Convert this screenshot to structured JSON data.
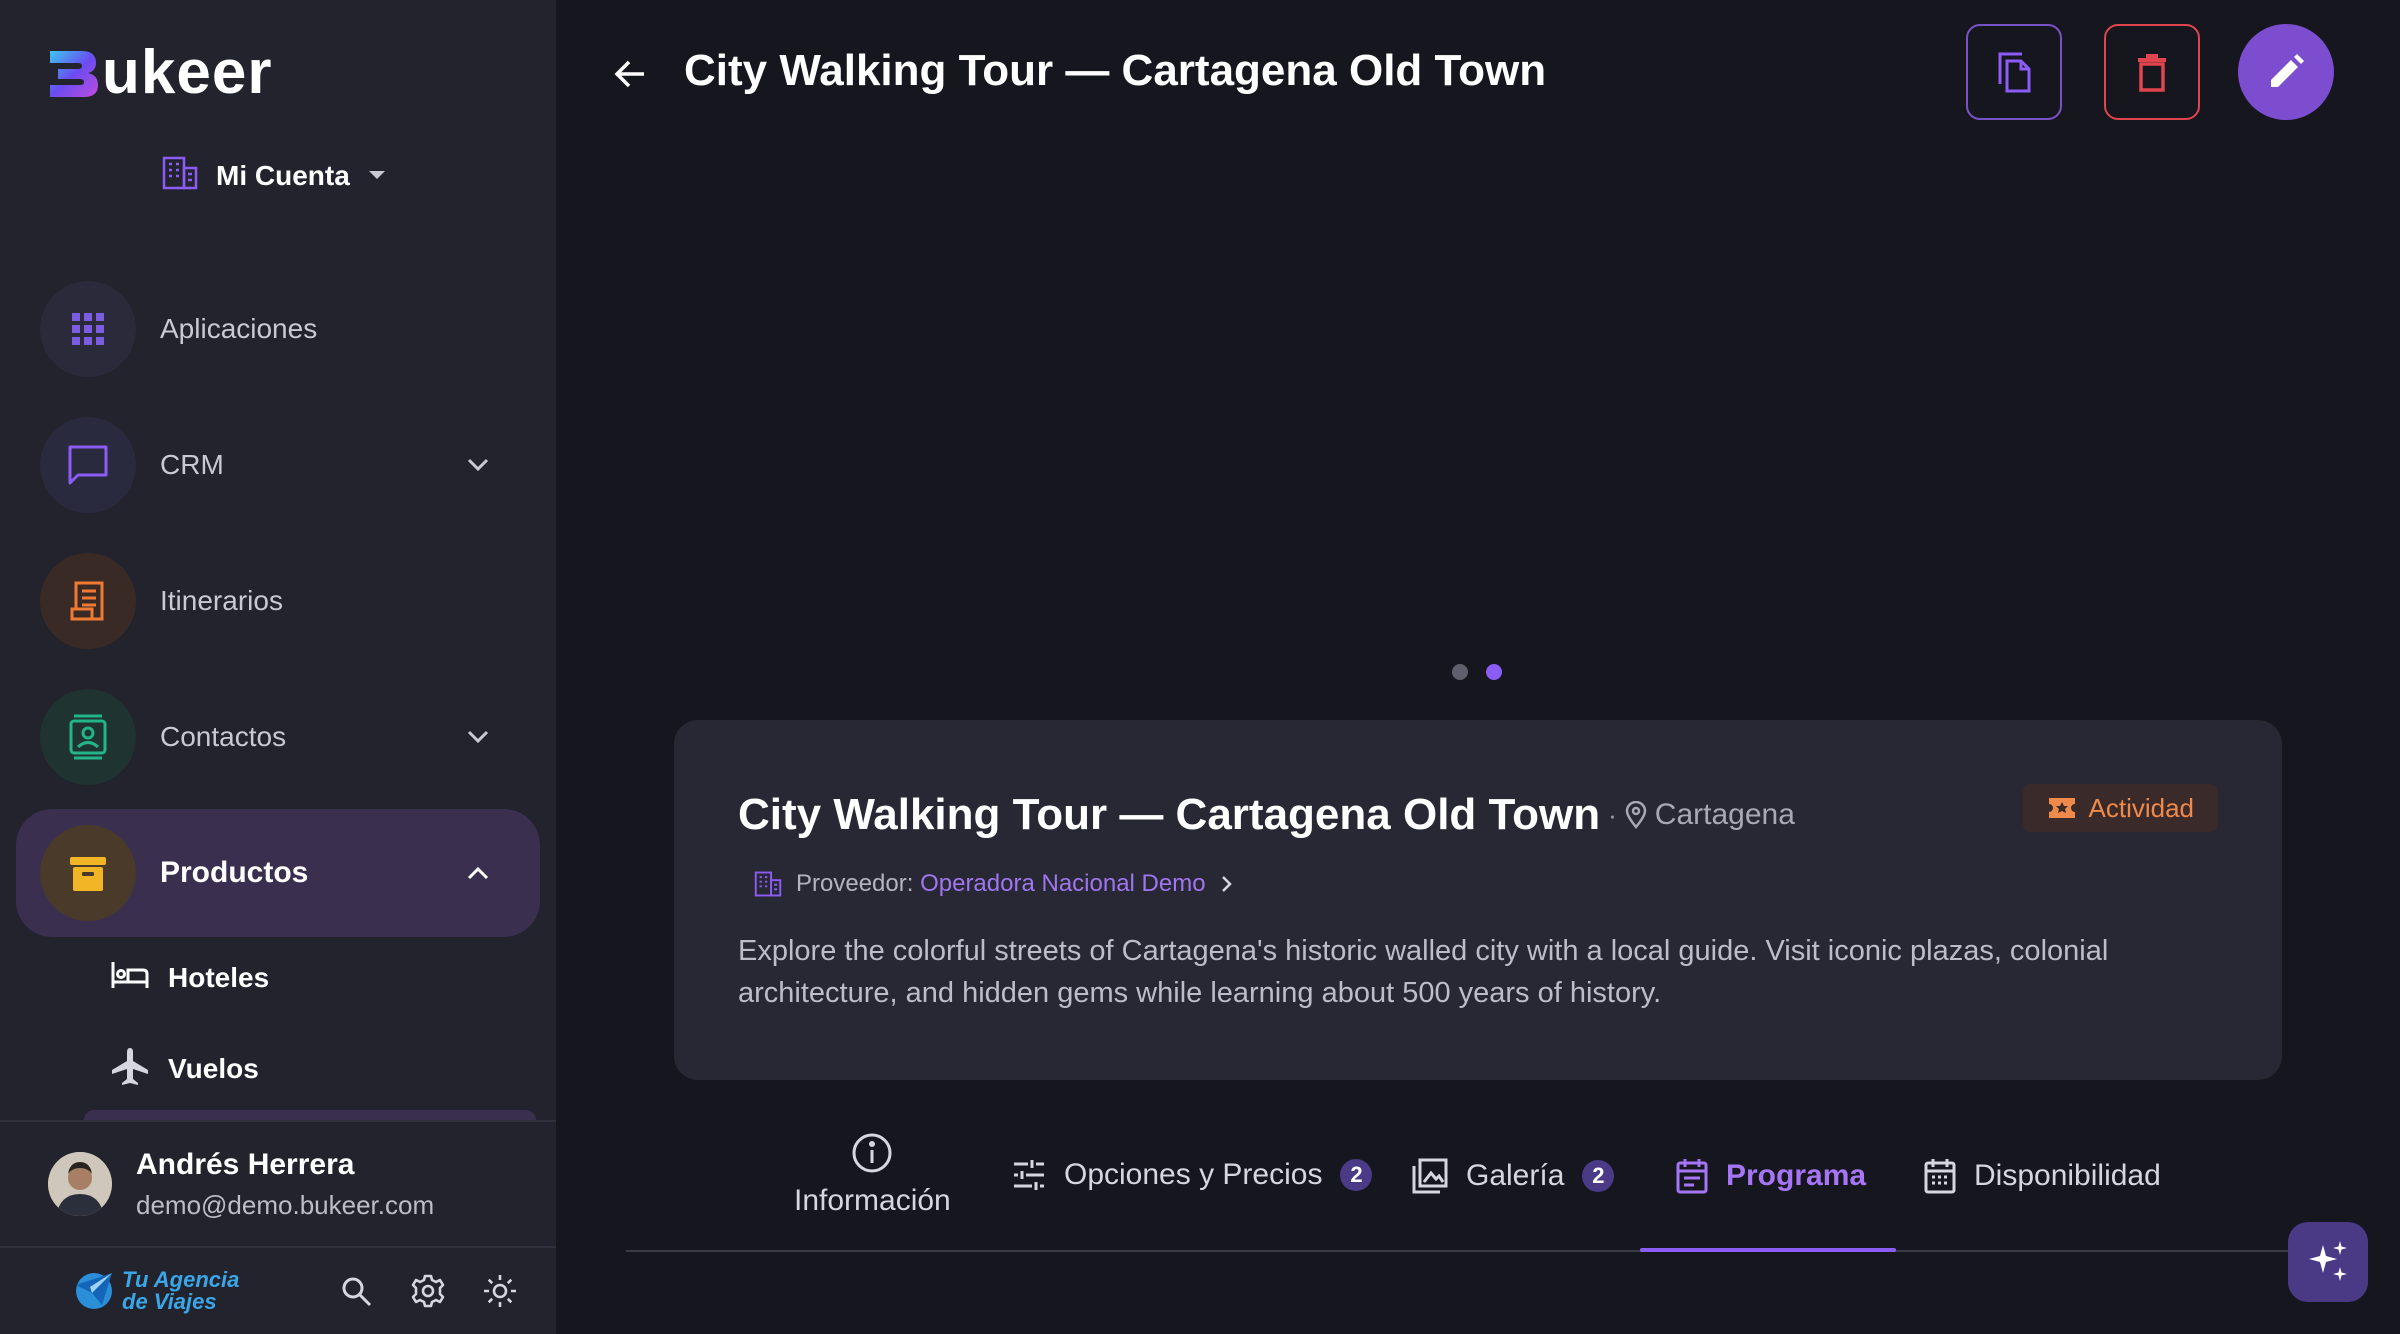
{
  "brand": {
    "logo_text": "ukeer",
    "colors": {
      "primary": "#8b5cf6",
      "danger": "#e0454d",
      "accent_orange": "#ef8a4a",
      "bg": "#16161f",
      "panel": "#22232d"
    }
  },
  "sidebar": {
    "account_label": "Mi Cuenta",
    "items": [
      {
        "label": "Aplicaciones",
        "icon": "apps-grid-icon"
      },
      {
        "label": "CRM",
        "icon": "chat-bubble-icon",
        "expandable": true
      },
      {
        "label": "Itinerarios",
        "icon": "document-list-icon"
      },
      {
        "label": "Contactos",
        "icon": "contact-card-icon",
        "expandable": true
      },
      {
        "label": "Productos",
        "icon": "archive-box-icon",
        "expandable": true,
        "active": true
      }
    ],
    "sub_items": [
      {
        "label": "Hoteles",
        "icon": "bed-icon"
      },
      {
        "label": "Vuelos",
        "icon": "airplane-icon"
      }
    ],
    "user": {
      "name": "Andrés Herrera",
      "email": "demo@demo.bukeer.com"
    },
    "agency": {
      "line1": "Tu Agencia",
      "line2": "de Viajes"
    }
  },
  "header": {
    "title": "City Walking Tour — Cartagena Old Town"
  },
  "carousel": {
    "count": 2,
    "active_index": 1
  },
  "product": {
    "title": "City Walking Tour — Cartagena Old Town",
    "separator": "·",
    "location": "Cartagena",
    "badge": "Actividad",
    "provider_label": "Proveedor:",
    "provider_name": "Operadora Nacional Demo",
    "description": "Explore the colorful streets of Cartagena's historic walled city with a local guide. Visit iconic plazas, colonial architecture, and hidden gems while learning about 500 years of history."
  },
  "tabs": [
    {
      "label": "Información"
    },
    {
      "label": "Opciones y Precios",
      "count": "2"
    },
    {
      "label": "Galería",
      "count": "2"
    },
    {
      "label": "Programa",
      "active": true
    },
    {
      "label": "Disponibilidad"
    }
  ]
}
